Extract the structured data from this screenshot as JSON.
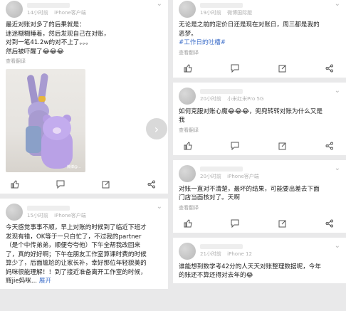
{
  "left_posts": [
    {
      "time": "14小时前",
      "source": "iPhone客户端",
      "lines": [
        "最近对账对多了的后果就是：",
        "迷迷糊糊睡着，然后发现自己在对账，",
        "对到一笔41.2w的对不上了。。。",
        "然后被吓醒了😂😂😂"
      ],
      "translate": "查看翻译",
      "photo_watermark": "微博@…"
    },
    {
      "time": "15小时前",
      "source": "iPhone客户端",
      "lines": [
        "今天感觉事事不顺，早上对账的时候到了临近下班才",
        "发现有错，OK等于一只白忙了，不过我的partner",
        "（是个中传弟弟，顺便夸夸他）下午全帮我改回来",
        "了，真的好好啊；下午在朋友工作室算课时费的时候",
        "算少了，后面尴尬的让家长补，幸好那位年轻貌美的",
        "妈咪很能理解！！到了接近准备离开工作室的时候，"
      ],
      "last_line": "辉jie妈咪...",
      "expand": "展开"
    }
  ],
  "right_posts": [
    {
      "time": "19小时前",
      "source": "微博国际版",
      "lines": [
        "无论是之前的定价日还是现在对账日，周三都是我的",
        "恶梦。"
      ],
      "tag": "#工作日的吐槽#",
      "translate": "查看翻译"
    },
    {
      "time": "20小时前",
      "source": "小米红米Pro 5G",
      "lines": [
        "如何克服对账心魔😂😂😂，兜兜转转对账为什么又是",
        "我"
      ],
      "translate": "查看翻译"
    },
    {
      "time": "20小时前",
      "source": "iPhone客户端",
      "lines": [
        "对账一直对不清楚，最坏的结果，可能要出差去下面",
        "门店当面核对了。天啊"
      ],
      "translate": "查看翻译"
    },
    {
      "time": "21小时前",
      "source": "iPhone 12",
      "lines": [
        "谁能想到数学考42分的人天天对账整理数据呢，今年",
        "的账还不算还得对去年的😂"
      ]
    }
  ],
  "icons": {
    "like": "like-icon",
    "comment": "comment-icon",
    "share": "share-icon",
    "more": "chevron-down-icon",
    "next": "chevron-right-icon"
  },
  "colors": {
    "link": "#3d6ec9",
    "meta": "#b0b0b0",
    "background": "#e9e9ea"
  }
}
